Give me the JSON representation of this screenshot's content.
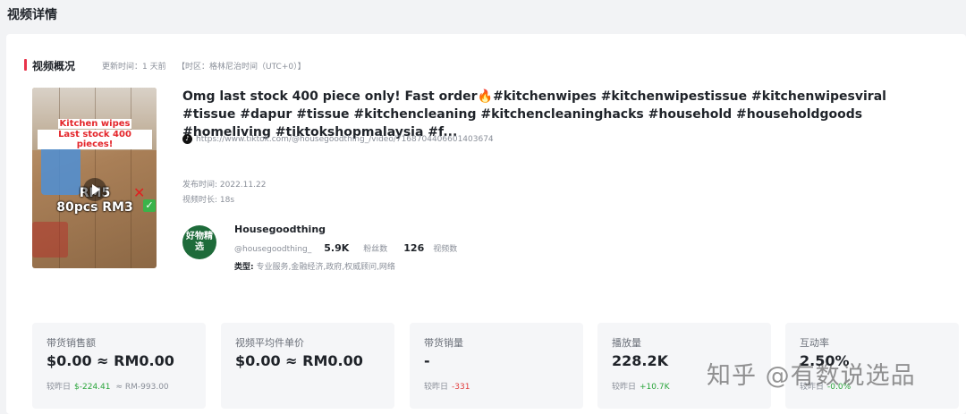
{
  "page": {
    "title": "视频详情"
  },
  "overview": {
    "section_title": "视频概况",
    "update_time": "更新时间：1 天前",
    "timezone": "【时区：格林尼治时间（UTC+0）】"
  },
  "thumbnail": {
    "caption_line1": "Kitchen wipes",
    "caption_line2": "Last stock 400 pieces!",
    "price_line1": "RM5",
    "price_line2": "80pcs RM3",
    "cross_mark": "✕",
    "check_mark": "✓"
  },
  "video": {
    "title": "Omg last stock 400 piece only! Fast order🔥#kitchenwipes #kitchenwipestissue #kitchenwipesviral #tissue #dapur #tissue #kitchencleaning #kitchencleaninghacks #household #householdgoods #homeliving #tiktokshopmalaysia #f...",
    "link": "https://www.tiktok.com/@housegoodthing_/video/7168704406601403674",
    "publish_date": "发布时间: 2022.11.22",
    "duration": "视频时长: 18s"
  },
  "author": {
    "avatar_text": "好物精选",
    "name": "Housegoodthing",
    "handle": "@housegoodthing_",
    "followers": "5.9K",
    "followers_label": "粉丝数",
    "videos": "126",
    "videos_label": "视频数",
    "type_label": "类型:",
    "type_value": "专业服务,金融经济,政府,权威顾问,网络"
  },
  "stats": [
    {
      "label": "带货销售额",
      "value": "$0.00 ≈ RM0.00",
      "compare_label": "较昨日",
      "delta": "$-224.41",
      "delta_class": "pos",
      "extra": "≈ RM-993.00"
    },
    {
      "label": "视频平均件单价",
      "value": "$0.00 ≈ RM0.00",
      "compare_label": "",
      "delta": "",
      "delta_class": "",
      "extra": ""
    },
    {
      "label": "带货销量",
      "value": "-",
      "compare_label": "较昨日",
      "delta": "-331",
      "delta_class": "neg",
      "extra": ""
    },
    {
      "label": "播放量",
      "value": "228.2K",
      "compare_label": "较昨日",
      "delta": "+10.7K",
      "delta_class": "pos",
      "extra": ""
    },
    {
      "label": "互动率",
      "value": "2.50%",
      "compare_label": "较昨日",
      "delta": "-0.0%",
      "delta_class": "pos",
      "extra": ""
    }
  ],
  "watermark": "知乎 @有数说选品",
  "colors": {
    "accent": "#e8334a",
    "positive": "#2aa53b",
    "negative": "#e23d3d"
  }
}
